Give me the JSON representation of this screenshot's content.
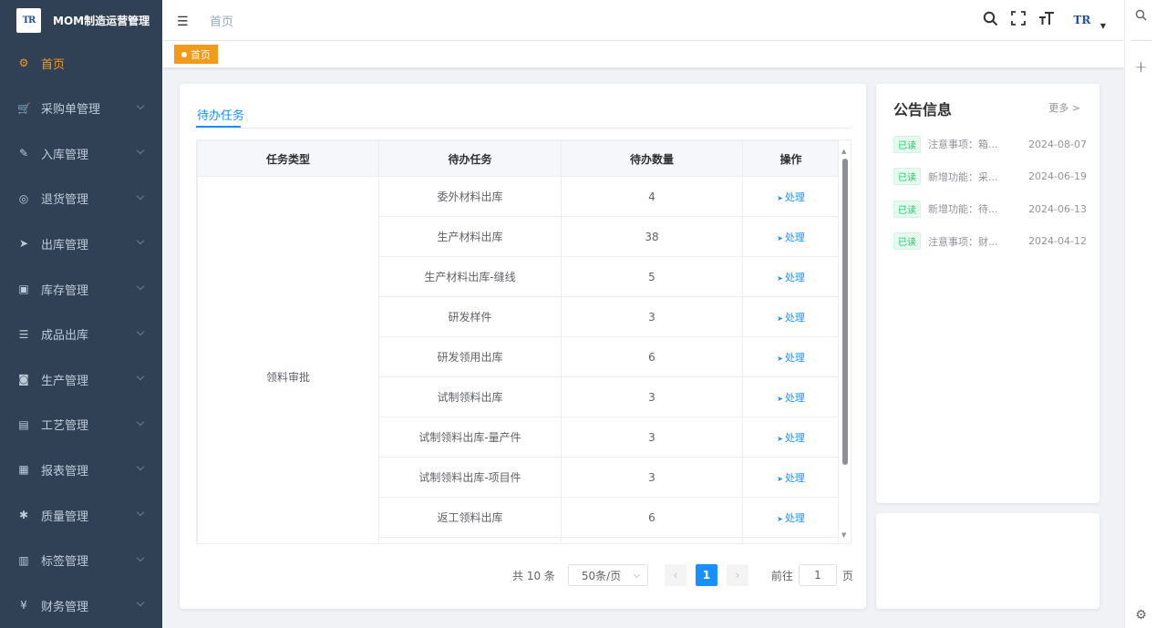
{
  "app": {
    "logo_text": "TR",
    "title": "MOM制造运营管理"
  },
  "colors": {
    "sidebar_bg": "#304156",
    "accent_orange": "#f29b1a",
    "primary_blue": "#1890ff",
    "read_green": "#13ce66"
  },
  "sidebar": {
    "items": [
      {
        "label": "首页",
        "icon": "dashboard-icon",
        "glyph": "⚙"
      },
      {
        "label": "采购单管理",
        "icon": "cart-icon",
        "glyph": "🛒"
      },
      {
        "label": "入库管理",
        "icon": "edit-icon",
        "glyph": "✎"
      },
      {
        "label": "退货管理",
        "icon": "return-icon",
        "glyph": "◎"
      },
      {
        "label": "出库管理",
        "icon": "send-icon",
        "glyph": "➤"
      },
      {
        "label": "库存管理",
        "icon": "monitor-icon",
        "glyph": "▣"
      },
      {
        "label": "成品出库",
        "icon": "list-icon",
        "glyph": "☰"
      },
      {
        "label": "生产管理",
        "icon": "production-icon",
        "glyph": "◙"
      },
      {
        "label": "工艺管理",
        "icon": "process-icon",
        "glyph": "▤"
      },
      {
        "label": "报表管理",
        "icon": "report-icon",
        "glyph": "▦"
      },
      {
        "label": "质量管理",
        "icon": "bug-icon",
        "glyph": "✱"
      },
      {
        "label": "标签管理",
        "icon": "tag-icon",
        "glyph": "▥"
      },
      {
        "label": "财务管理",
        "icon": "yen-icon",
        "glyph": "¥"
      }
    ]
  },
  "header": {
    "breadcrumb": "首页",
    "hamburger_icon": "menu-fold-icon",
    "user_logo": "TR"
  },
  "tags": {
    "active": "首页"
  },
  "todo": {
    "tab": "待办任务",
    "columns": [
      "任务类型",
      "待办任务",
      "待办数量",
      "操作"
    ],
    "group_label": "领料审批",
    "rows": [
      {
        "task": "委外材料出库",
        "count": "4",
        "action": "处理"
      },
      {
        "task": "生产材料出库",
        "count": "38",
        "action": "处理"
      },
      {
        "task": "生产材料出库-缝线",
        "count": "5",
        "action": "处理"
      },
      {
        "task": "研发样件",
        "count": "3",
        "action": "处理"
      },
      {
        "task": "研发领用出库",
        "count": "6",
        "action": "处理"
      },
      {
        "task": "试制领料出库",
        "count": "3",
        "action": "处理"
      },
      {
        "task": "试制领料出库-量产件",
        "count": "3",
        "action": "处理"
      },
      {
        "task": "试制领料出库-项目件",
        "count": "3",
        "action": "处理"
      },
      {
        "task": "返工领料出库",
        "count": "6",
        "action": "处理"
      }
    ],
    "pagination": {
      "total": "共 10 条",
      "page_size": "50条/页",
      "current": "1",
      "goto_label": "前往",
      "goto_value": "1",
      "page_suffix": "页"
    }
  },
  "notices": {
    "title": "公告信息",
    "more": "更多 >",
    "items": [
      {
        "status": "已读",
        "text": "注意事项：箱...",
        "date": "2024-08-07"
      },
      {
        "status": "已读",
        "text": "新增功能：采...",
        "date": "2024-06-19"
      },
      {
        "status": "已读",
        "text": "新增功能：待...",
        "date": "2024-06-13"
      },
      {
        "status": "已读",
        "text": "注意事项：财...",
        "date": "2024-04-12"
      }
    ]
  }
}
